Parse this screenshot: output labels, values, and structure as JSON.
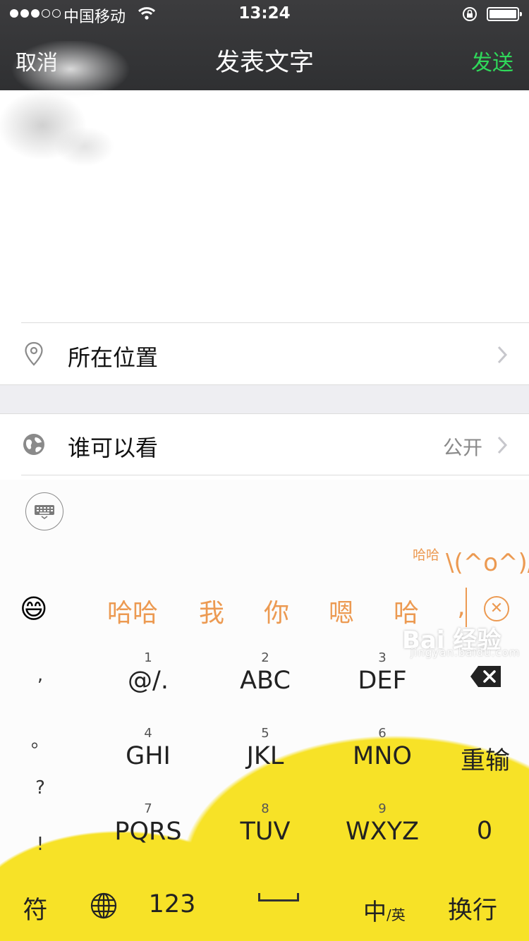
{
  "status_bar": {
    "carrier": "中国移动",
    "time": "13:24"
  },
  "nav": {
    "cancel_label": "取消",
    "title": "发表文字",
    "send_label": "发送",
    "send_color": "#2fd85a"
  },
  "list": {
    "location_label": "所在位置",
    "visibility_label": "谁可以看",
    "visibility_value": "公开"
  },
  "keyboard": {
    "pinyin_hint": "哈哈",
    "kaomoji": "\\(^o^)/",
    "emoji": "😄",
    "candidates": [
      "哈哈",
      "我",
      "你",
      "嗯",
      "哈",
      ","
    ],
    "candidate_color": "#ec9a52",
    "punctuation": [
      ",",
      "。",
      "?",
      "!"
    ],
    "keys": [
      {
        "num": "1",
        "letters": "@/."
      },
      {
        "num": "2",
        "letters": "ABC"
      },
      {
        "num": "3",
        "letters": "DEF"
      },
      {
        "num": "4",
        "letters": "GHI"
      },
      {
        "num": "5",
        "letters": "JKL"
      },
      {
        "num": "6",
        "letters": "MNO"
      },
      {
        "num": "7",
        "letters": "PQRS"
      },
      {
        "num": "8",
        "letters": "TUV"
      },
      {
        "num": "9",
        "letters": "WXYZ"
      }
    ],
    "reenter_label": "重输",
    "zero_label": "0",
    "symbol_label": "符",
    "numbers_label": "123",
    "lang_main": "中",
    "lang_sub": "英",
    "enter_label": "换行"
  },
  "watermark": {
    "text": "Bai 经验",
    "url": "jingyan.baidu.com"
  },
  "icons": [
    "location-pin-icon",
    "globe-icon",
    "chevron-right-icon",
    "keyboard-icon",
    "backspace-icon",
    "globe-switch-icon",
    "clear-icon"
  ]
}
